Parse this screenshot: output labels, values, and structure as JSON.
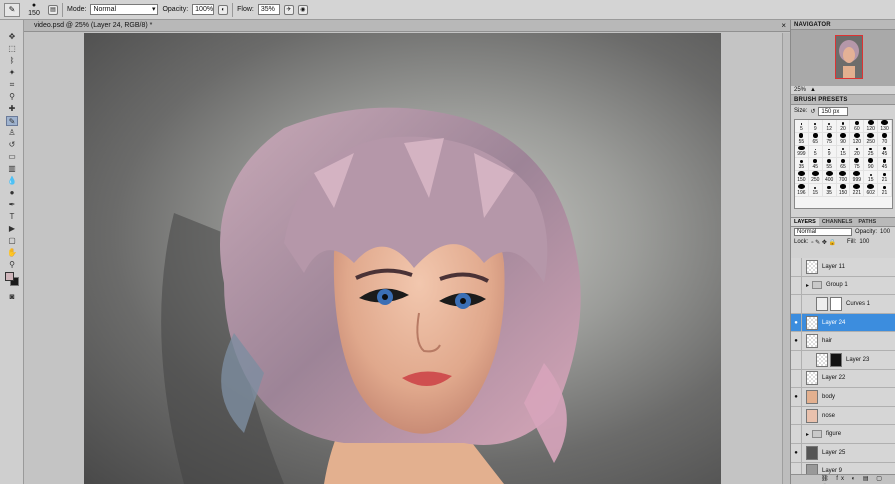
{
  "options_bar": {
    "brush_size": "150",
    "mode_label": "Mode:",
    "mode_value": "Normal",
    "opacity_label": "Opacity:",
    "opacity_value": "100%",
    "flow_label": "Flow:",
    "flow_value": "35%"
  },
  "document": {
    "title": "video.psd @ 25% (Layer 24, RGB/8) *"
  },
  "navigator": {
    "title": "NAVIGATOR",
    "zoom": "25%"
  },
  "brush_presets": {
    "title": "BRUSH PRESETS",
    "size_label": "Size:",
    "size_value": "150 px",
    "rows": [
      [
        "5",
        "9",
        "12",
        "20",
        "60",
        "120",
        "130"
      ],
      [
        "55",
        "65",
        "75",
        "90",
        "120",
        "250",
        "70"
      ],
      [
        "999",
        "5",
        "9",
        "15",
        "20",
        "25",
        "45"
      ],
      [
        "35",
        "45",
        "55",
        "65",
        "75",
        "90",
        "45"
      ],
      [
        "150",
        "250",
        "400",
        "700",
        "999",
        "15",
        "21"
      ],
      [
        "196",
        "15",
        "35",
        "150",
        "221",
        "602",
        "21"
      ]
    ]
  },
  "layers_panel": {
    "tabs": [
      "LAYERS",
      "CHANNELS",
      "PATHS"
    ],
    "blend_mode": "Normal",
    "opacity_label": "Opacity:",
    "opacity_value": "100",
    "lock_label": "Lock:",
    "fill_label": "Fill:",
    "fill_value": "100",
    "layers": [
      {
        "name": "Layer 11"
      },
      {
        "name": "Group 1"
      },
      {
        "name": "Curves 1"
      },
      {
        "name": "Layer 24"
      },
      {
        "name": "hair"
      },
      {
        "name": "Layer 23"
      },
      {
        "name": "Layer 22"
      },
      {
        "name": "body"
      },
      {
        "name": "nose"
      },
      {
        "name": "figure"
      },
      {
        "name": "Layer 25"
      },
      {
        "name": "Layer 9"
      }
    ]
  },
  "colors": {
    "selection": "#3c8dde",
    "hair": "#b99aaa",
    "skin": "#e8b69a"
  }
}
